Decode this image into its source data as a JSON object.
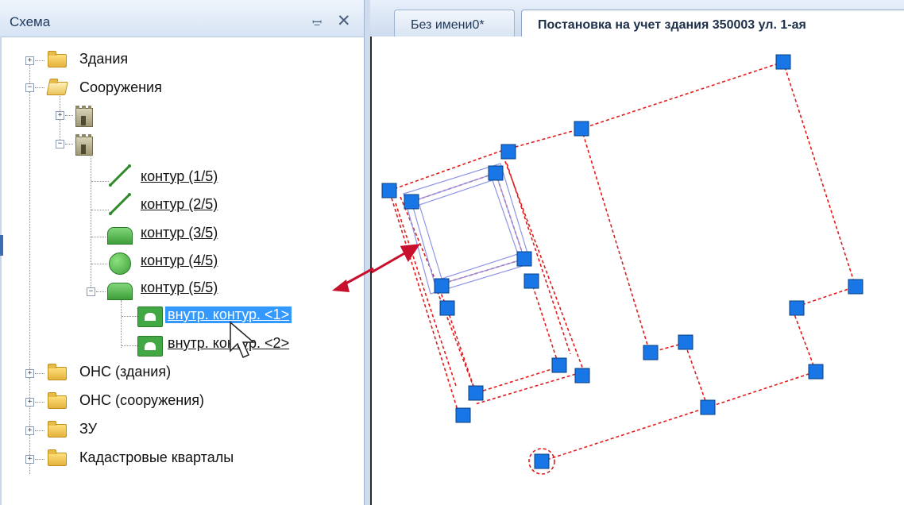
{
  "panel": {
    "title": "Схема",
    "pin_icon": "pin-icon",
    "close_icon": "close-icon"
  },
  "tree": {
    "items": [
      {
        "label": "Здания"
      },
      {
        "label": "Сооружения"
      },
      {
        "label": "контур (1/5)"
      },
      {
        "label": "контур (2/5)"
      },
      {
        "label": "контур (3/5)"
      },
      {
        "label": "контур (4/5)"
      },
      {
        "label": "контур (5/5)"
      },
      {
        "label": "внутр. контур. <1>"
      },
      {
        "label": "внутр. контур. <2>"
      },
      {
        "label": "ОНС (здания)"
      },
      {
        "label": "ОНС (сооружения)"
      },
      {
        "label": "ЗУ"
      },
      {
        "label": "Кадастровые кварталы"
      }
    ]
  },
  "tabs": {
    "unnamed": "Без имени0*",
    "active": "Постановка на учет здания 350003 ул. 1-ая"
  },
  "colors": {
    "accent": "#3399ff",
    "handle": "#1976e6",
    "contour_line": "#e31b1b",
    "inner_line": "#8f95e8",
    "arrow": "#c8102e"
  }
}
